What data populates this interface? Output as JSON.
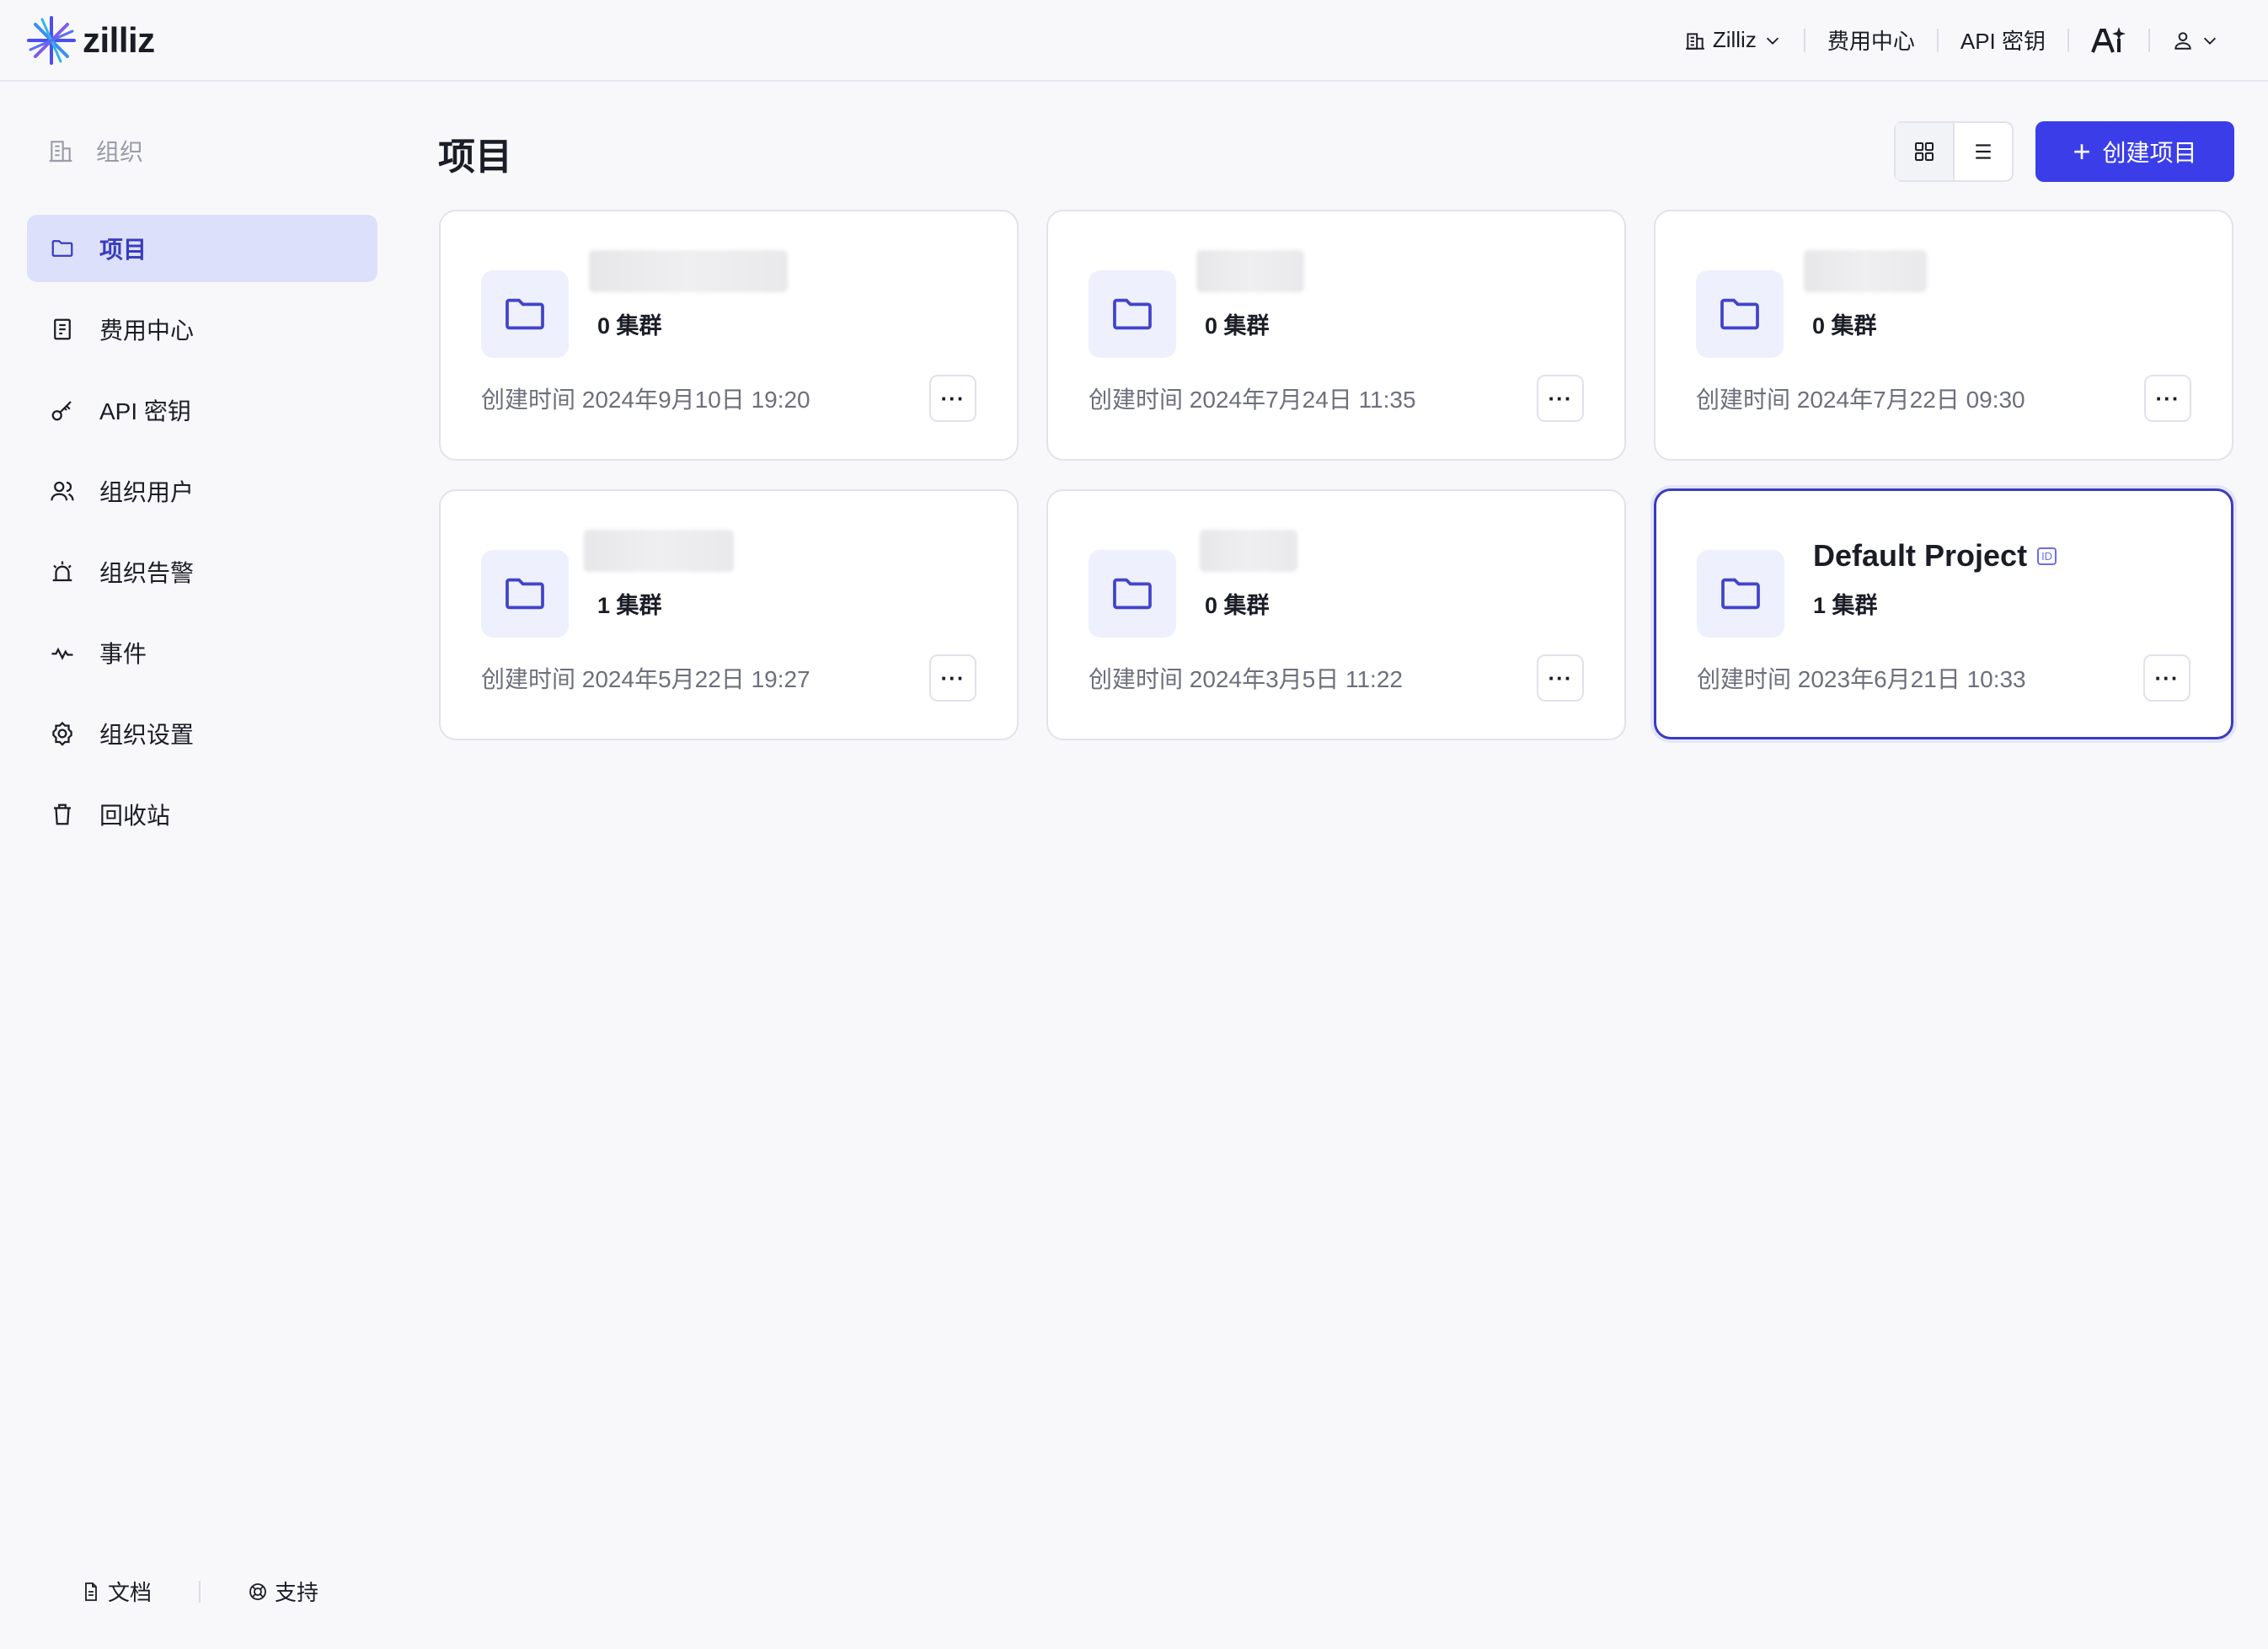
{
  "header": {
    "logo_text": "zilliz",
    "org_switcher": "Zilliz",
    "billing": "费用中心",
    "api_keys": "API 密钥"
  },
  "sidebar": {
    "org_label": "组织",
    "items": [
      {
        "label": "项目",
        "icon": "folder-icon",
        "active": true
      },
      {
        "label": "费用中心",
        "icon": "receipt-icon"
      },
      {
        "label": "API 密钥",
        "icon": "key-icon"
      },
      {
        "label": "组织用户",
        "icon": "users-icon"
      },
      {
        "label": "组织告警",
        "icon": "alarm-icon"
      },
      {
        "label": "事件",
        "icon": "activity-icon"
      },
      {
        "label": "组织设置",
        "icon": "gear-icon"
      },
      {
        "label": "回收站",
        "icon": "trash-icon"
      }
    ],
    "footer": {
      "docs": "文档",
      "support": "支持"
    }
  },
  "main": {
    "title": "项目",
    "create_button": "创建项目",
    "projects": [
      {
        "name": "",
        "clusters": "0 集群",
        "created": "创建时间 2024年9月10日 19:20",
        "blurred": true
      },
      {
        "name": "",
        "clusters": "0 集群",
        "created": "创建时间 2024年7月24日 11:35",
        "blurred": true
      },
      {
        "name": "",
        "clusters": "0 集群",
        "created": "创建时间 2024年7月22日 09:30",
        "blurred": true
      },
      {
        "name": "",
        "clusters": "1 集群",
        "created": "创建时间 2024年5月22日 19:27",
        "blurred": true
      },
      {
        "name": "",
        "clusters": "0 集群",
        "created": "创建时间 2024年3月5日 11:22",
        "blurred": true
      },
      {
        "name": "Default Project",
        "id_badge": "ID",
        "clusters": "1 集群",
        "created": "创建时间 2023年6月21日 10:33",
        "blurred": false,
        "selected": true
      }
    ]
  },
  "colors": {
    "accent": "#3b3ee8",
    "active_bg": "#dde0fb",
    "folder_bg": "#eef0fd"
  }
}
